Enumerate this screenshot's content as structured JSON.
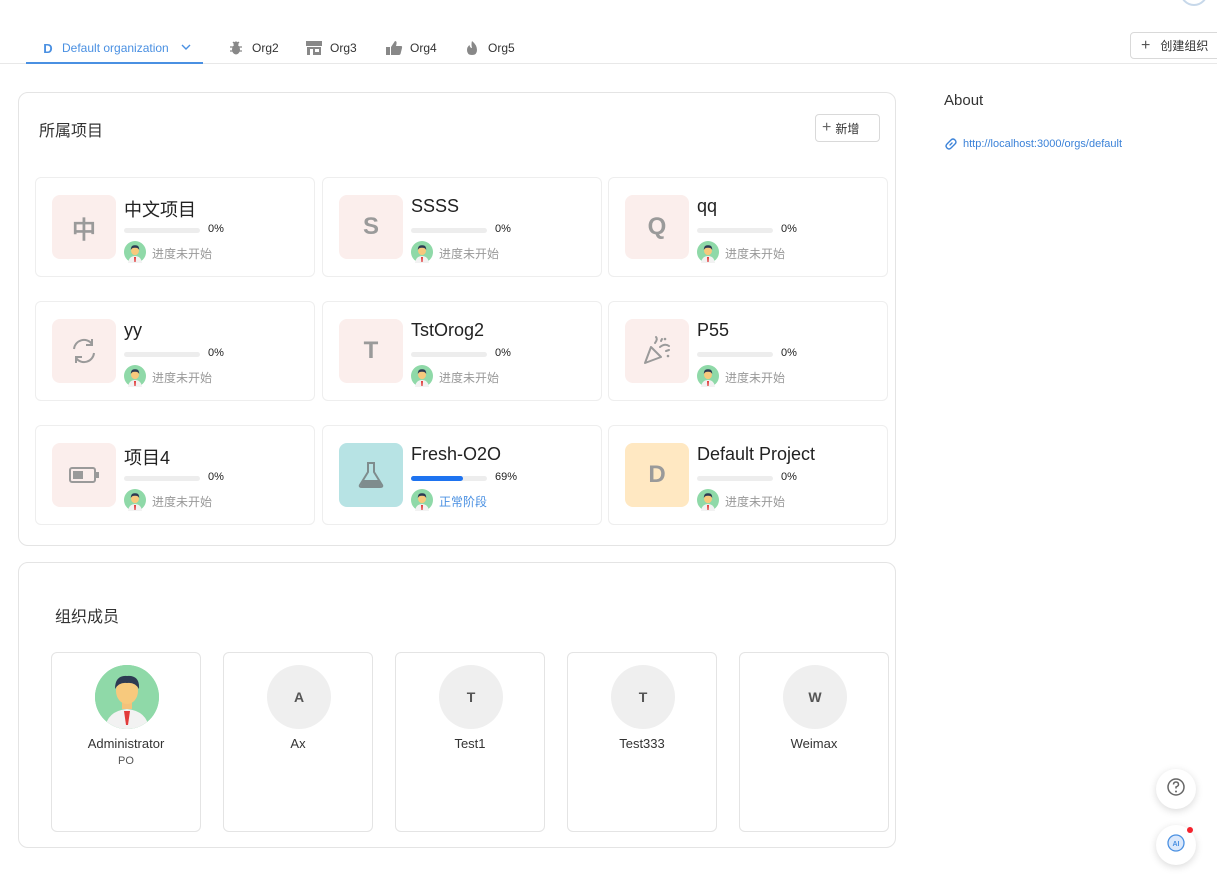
{
  "tabs": [
    {
      "badge": "D",
      "label": "Default organization",
      "icon": "letter-d-icon",
      "active": true
    },
    {
      "label": "Org2",
      "icon": "bug-icon"
    },
    {
      "label": "Org3",
      "icon": "store-icon"
    },
    {
      "label": "Org4",
      "icon": "thumbs-up-icon"
    },
    {
      "label": "Org5",
      "icon": "fire-icon"
    }
  ],
  "create_org_label": "创建组织",
  "projects_section": {
    "title": "所属项目",
    "add_label": "新增",
    "items": [
      {
        "name": "中文项目",
        "icon_text": "中",
        "progress": 0,
        "progress_label": "0%",
        "status": "进度未开始"
      },
      {
        "name": "SSSS",
        "icon_text": "S",
        "progress": 0,
        "progress_label": "0%",
        "status": "进度未开始"
      },
      {
        "name": "qq",
        "icon_text": "Q",
        "progress": 0,
        "progress_label": "0%",
        "status": "进度未开始"
      },
      {
        "name": "yy",
        "icon": "refresh-icon",
        "progress": 0,
        "progress_label": "0%",
        "status": "进度未开始"
      },
      {
        "name": "TstOrog2",
        "icon_text": "T",
        "progress": 0,
        "progress_label": "0%",
        "status": "进度未开始"
      },
      {
        "name": "P55",
        "icon": "party-popper-icon",
        "progress": 0,
        "progress_label": "0%",
        "status": "进度未开始"
      },
      {
        "name": "项目4",
        "icon": "battery-icon",
        "progress": 0,
        "progress_label": "0%",
        "status": "进度未开始"
      },
      {
        "name": "Fresh-O2O",
        "icon": "flask-icon",
        "progress": 69,
        "progress_label": "69%",
        "status": "正常阶段"
      },
      {
        "name": "Default Project",
        "icon_text": "D",
        "progress": 0,
        "progress_label": "0%",
        "status": "进度未开始"
      }
    ]
  },
  "members_section": {
    "title": "组织成员",
    "members": [
      {
        "name": "Administrator",
        "role": "PO",
        "avatar": "person-avatar"
      },
      {
        "name": "Ax",
        "initial": "A"
      },
      {
        "name": "Test1",
        "initial": "T"
      },
      {
        "name": "Test333",
        "initial": "T"
      },
      {
        "name": "Weimax",
        "initial": "W"
      }
    ]
  },
  "about": {
    "title": "About",
    "link": "http://localhost:3000/orgs/default"
  },
  "colors": {
    "accent": "#4a90e2",
    "progress_fill": "#1e73f0",
    "icon_bg_pink": "#fbeeec",
    "icon_bg_teal": "#b7e3e4",
    "icon_bg_yellow": "#ffe8c2"
  }
}
